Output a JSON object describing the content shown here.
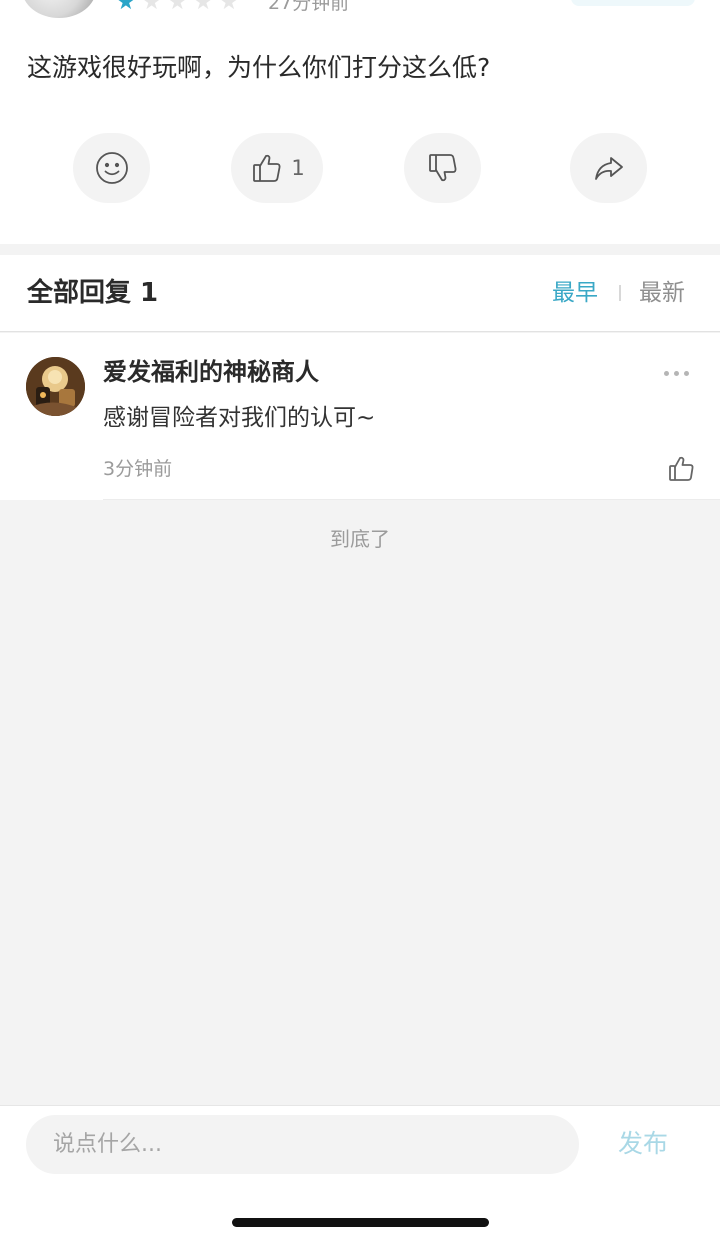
{
  "review": {
    "rating": 1,
    "rating_max": 5,
    "time": "27分钟前",
    "text": "这游戏很好玩啊，为什么你们打分这么低?",
    "like_count": "1"
  },
  "replies": {
    "title": "全部回复 1",
    "sort_earliest": "最早",
    "sort_latest": "最新",
    "active_sort": "最早",
    "items": [
      {
        "author": "爱发福利的神秘商人",
        "text": "感谢冒险者对我们的认可~",
        "time": "3分钟前"
      }
    ],
    "end_text": "到底了"
  },
  "composer": {
    "placeholder": "说点什么...",
    "publish_label": "发布"
  },
  "colors": {
    "accent": "#3aa8c6",
    "star_active": "#2aa5c8",
    "publish_disabled": "#a9d8e6"
  }
}
